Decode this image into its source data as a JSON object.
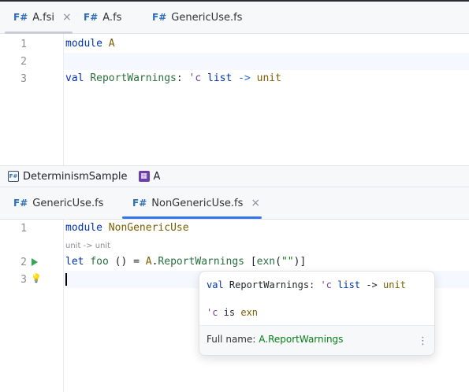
{
  "top_pane": {
    "tabs": [
      {
        "lang": "F#",
        "label": "A.fsi",
        "active": true,
        "closable": true
      },
      {
        "lang": "F#",
        "label": "A.fs",
        "active": false,
        "closable": false
      },
      {
        "lang": "F#",
        "label": "GenericUse.fs",
        "active": false,
        "closable": false
      }
    ],
    "close_glyph": "×",
    "lines": [
      {
        "num": "1",
        "tokens": [
          [
            "kw",
            "module"
          ],
          [
            "plain",
            " "
          ],
          [
            "mod",
            "A"
          ]
        ]
      },
      {
        "num": "2",
        "tokens": []
      },
      {
        "num": "3",
        "tokens": [
          [
            "kw",
            "val"
          ],
          [
            "plain",
            " "
          ],
          [
            "func",
            "ReportWarnings"
          ],
          [
            "plain",
            ": "
          ],
          [
            "typ",
            "'c"
          ],
          [
            "plain",
            " "
          ],
          [
            "kw",
            "list"
          ],
          [
            "plain",
            " "
          ],
          [
            "op",
            "->"
          ],
          [
            "plain",
            " "
          ],
          [
            "mod",
            "unit"
          ]
        ]
      }
    ]
  },
  "breadcrumb": {
    "project": "DeterminismSample",
    "namespace": "A"
  },
  "bottom_pane": {
    "tabs": [
      {
        "lang": "F#",
        "label": "GenericUse.fs",
        "active": false,
        "closable": false
      },
      {
        "lang": "F#",
        "label": "NonGenericUse.fs",
        "active": true,
        "closable": true
      }
    ],
    "close_glyph": "×",
    "lines": [
      {
        "num": "1",
        "tokens": [
          [
            "kw",
            "module"
          ],
          [
            "plain",
            " "
          ],
          [
            "mod",
            "NonGenericUse"
          ]
        ]
      },
      {
        "num": "2",
        "tokens": [
          [
            "kw",
            "let"
          ],
          [
            "plain",
            " "
          ],
          [
            "func",
            "foo"
          ],
          [
            "plain",
            " () = "
          ],
          [
            "mod",
            "A"
          ],
          [
            "plain",
            "."
          ],
          [
            "func",
            "ReportWarnings"
          ],
          [
            "plain",
            " ["
          ],
          [
            "func",
            "exn"
          ],
          [
            "plain",
            "("
          ],
          [
            "str",
            "\"\""
          ],
          [
            "plain",
            ")]"
          ]
        ]
      },
      {
        "num": "3",
        "tokens": []
      }
    ],
    "inlay_hint": "unit -> unit"
  },
  "popup": {
    "signature": [
      [
        "kw",
        "val"
      ],
      [
        "plain",
        " ReportWarnings: "
      ],
      [
        "typ",
        "'c"
      ],
      [
        "plain",
        " "
      ],
      [
        "kw",
        "list"
      ],
      [
        "plain",
        " -> "
      ],
      [
        "mod",
        "unit"
      ]
    ],
    "generic": [
      [
        "typ",
        "'c"
      ],
      [
        "plain",
        " is "
      ],
      [
        "mod",
        "exn"
      ]
    ],
    "fullname_label": "Full name:",
    "fullname_value": "A.ReportWarnings",
    "more_glyph": "⋮"
  },
  "colors": {
    "accent": "#3574f0",
    "run": "#3aa655",
    "fsharp": "#2e6fba"
  }
}
